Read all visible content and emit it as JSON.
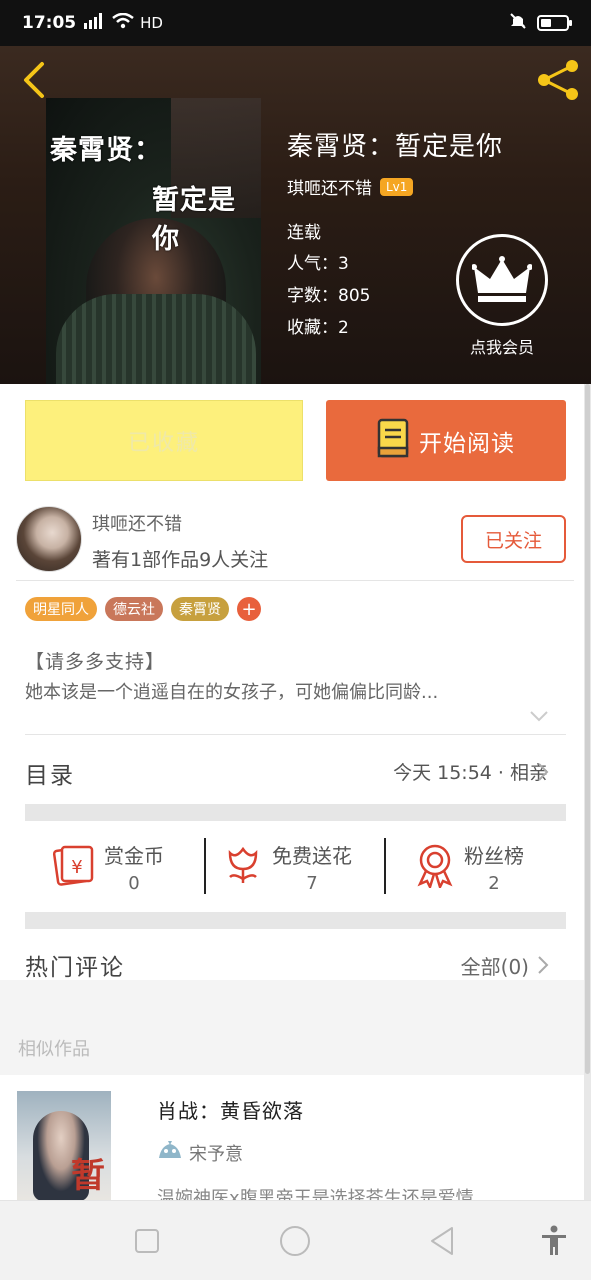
{
  "status_bar": {
    "time": "17:05",
    "network": "4G",
    "hd": "HD"
  },
  "book": {
    "cover_line1": "秦霄贤：",
    "cover_line2": "暂定是你",
    "title": "秦霄贤：暂定是你",
    "author": "琪咂还不错",
    "level": "Lv1",
    "status": "连载",
    "popularity": "人气：3",
    "word_count": "字数：805",
    "favorites": "收藏：2"
  },
  "vip": {
    "label": "点我会员"
  },
  "actions": {
    "collected_label": "已收藏",
    "read_label": "开始阅读"
  },
  "author_card": {
    "name": "琪咂还不错",
    "stats": "著有1部作品9人关注",
    "follow_label": "已关注"
  },
  "tags": [
    {
      "label": "明星同人",
      "color": "#f0a23a"
    },
    {
      "label": "德云社",
      "color": "#c9775a"
    },
    {
      "label": "秦霄贤",
      "color": "#c7a03e"
    }
  ],
  "intro": {
    "heading": "【请多多支持】",
    "text": "她本该是一个逍遥自在的女孩子，可她偏偏比同龄..."
  },
  "toc": {
    "label": "目录",
    "latest": "今天 15:54 · 相亲"
  },
  "stats": [
    {
      "label": "赏金币",
      "value": "0",
      "icon": "red-envelope-icon"
    },
    {
      "label": "免费送花",
      "value": "7",
      "icon": "flower-icon"
    },
    {
      "label": "粉丝榜",
      "value": "2",
      "icon": "award-ribbon-icon"
    }
  ],
  "comments": {
    "label": "热门评论",
    "all_label": "全部(0)"
  },
  "similar": {
    "heading": "相似作品",
    "items": [
      {
        "title": "肖战：黄昏欲落",
        "author": "宋予意",
        "desc": "温婉神医x腹黑帝王是选择苍生还是爱情",
        "cover_text": "暂"
      }
    ]
  },
  "colors": {
    "accent": "#e96a3d",
    "collected_bg": "#fdf07c",
    "follow": "#e55a3a",
    "level_badge": "#f5a623"
  }
}
